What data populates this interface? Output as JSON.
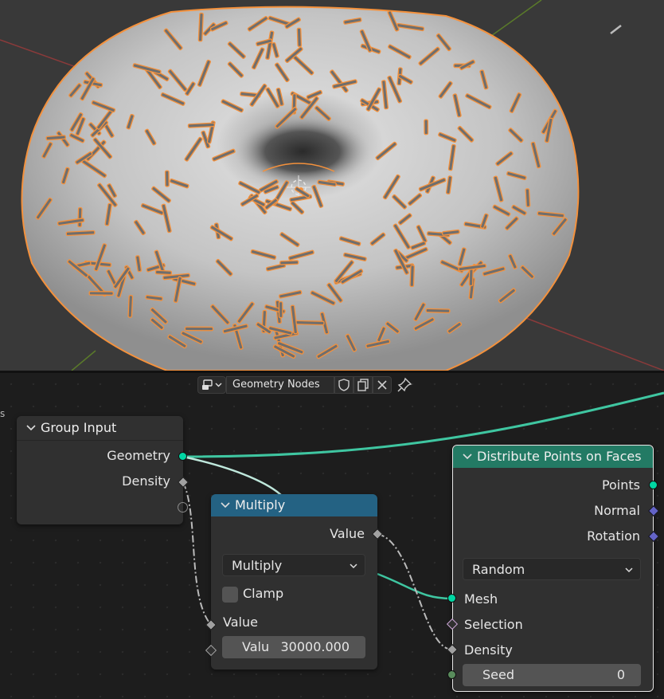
{
  "editor": {
    "header": {
      "tree_name": "Geometry Nodes",
      "editor_type_icon": "node-editor-icon",
      "fake_user_icon": "shield-icon",
      "duplicate_icon": "duplicate-icon",
      "close_icon": "close-icon",
      "pin_icon": "pin-icon"
    },
    "edge_letter": "s"
  },
  "nodes": {
    "group_input": {
      "title": "Group Input",
      "outputs": [
        "Geometry",
        "Density"
      ]
    },
    "multiply": {
      "title": "Multiply",
      "output": "Value",
      "operation": "Multiply",
      "clamp_label": "Clamp",
      "clamp_checked": false,
      "input_label": "Value",
      "field_label": "Valu",
      "field_value": "30000.000"
    },
    "distribute": {
      "title": "Distribute Points on Faces",
      "outputs": [
        "Points",
        "Normal",
        "Rotation"
      ],
      "mode": "Random",
      "inputs": [
        "Mesh",
        "Selection",
        "Density"
      ],
      "seed_label": "Seed",
      "seed_value": "0"
    }
  },
  "colors": {
    "geometry_socket": "#00d6a3",
    "vector_socket": "#6363c7",
    "float_socket": "#a1a1a1",
    "bool_socket": "#cca6d6",
    "int_socket": "#598c5c",
    "multiply_header": "#246283",
    "distribute_header": "#237a64",
    "selection_outline": "#f4913c"
  }
}
